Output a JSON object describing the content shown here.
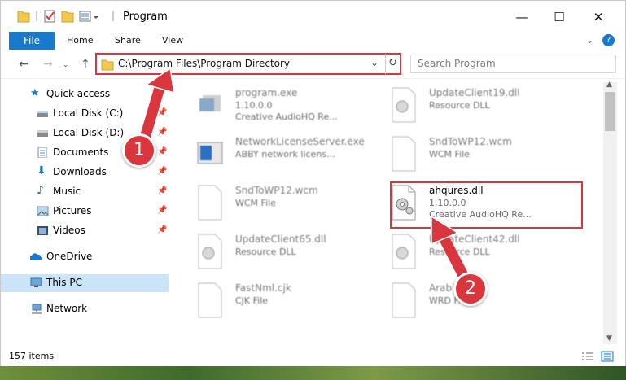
{
  "window": {
    "title": "Program",
    "controls": {
      "minimize": "—",
      "maximize": "☐",
      "close": "✕"
    }
  },
  "ribbon": {
    "tabs": [
      "File",
      "Home",
      "Share",
      "View"
    ],
    "help": "?"
  },
  "address": {
    "path": "C:\\Program Files\\Program Directory"
  },
  "search": {
    "placeholder": "Search Program"
  },
  "sidebar": {
    "items": [
      {
        "label": "Quick access",
        "icon": "star-icon",
        "pinned": false
      },
      {
        "label": "Local Disk (C:)",
        "icon": "drive-icon",
        "pinned": true
      },
      {
        "label": "Local Disk (D:)",
        "icon": "drive-icon",
        "pinned": true
      },
      {
        "label": "Documents",
        "icon": "documents-icon",
        "pinned": true
      },
      {
        "label": "Downloads",
        "icon": "downloads-icon",
        "pinned": true
      },
      {
        "label": "Music",
        "icon": "music-icon",
        "pinned": true
      },
      {
        "label": "Pictures",
        "icon": "pictures-icon",
        "pinned": true
      },
      {
        "label": "Videos",
        "icon": "videos-icon",
        "pinned": true
      },
      {
        "label": "OneDrive",
        "icon": "cloud-icon",
        "pinned": false
      },
      {
        "label": "This PC",
        "icon": "computer-icon",
        "pinned": false,
        "selected": true
      },
      {
        "label": "Network",
        "icon": "network-icon",
        "pinned": false
      }
    ]
  },
  "files": [
    {
      "name": "program.exe",
      "line2": "1.10.0.0",
      "line3": "Creative AudioHQ Re..."
    },
    {
      "name": "UpdateClient19.dll",
      "line2": "Resource DLL",
      "line3": ""
    },
    {
      "name": "NetworkLicenseServer.exe",
      "line2": "ABBY network licens...",
      "line3": ""
    },
    {
      "name": "SndToWP12.wcm",
      "line2": "WCM File",
      "line3": ""
    },
    {
      "name": "SndToWP12.wcm",
      "line2": "WCM File",
      "line3": ""
    },
    {
      "name": "ahqures.dll",
      "line2": "1.10.0.0",
      "line3": "Creative AudioHQ Re..."
    },
    {
      "name": "UpdateClient65.dll",
      "line2": "Resource DLL",
      "line3": ""
    },
    {
      "name": "UpdateClient42.dll",
      "line2": "Resource DLL",
      "line3": ""
    },
    {
      "name": "FastNml.cjk",
      "line2": "CJK File",
      "line3": ""
    },
    {
      "name": "Arabic",
      "line2": "WRD File",
      "line3": ""
    }
  ],
  "status": {
    "item_count": "157 items"
  },
  "annotations": {
    "badge1": "1",
    "badge2": "2",
    "color": "#d9363e"
  }
}
